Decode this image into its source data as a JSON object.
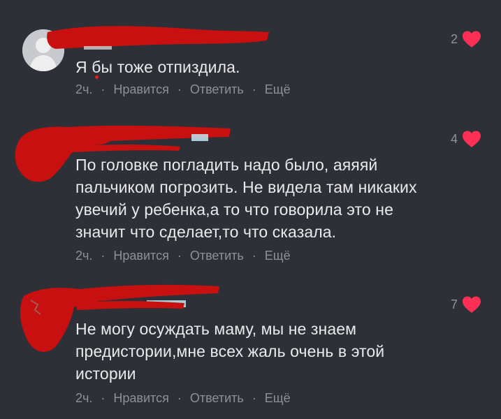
{
  "comments": [
    {
      "text": "Я бы тоже отпиздила.",
      "likes": "2",
      "time": "2ч.",
      "like_label": "Нравится",
      "reply_label": "Ответить",
      "more_label": "Ещё"
    },
    {
      "text": "По головке погладить надо было, аяяяй\nпальчиком погрозить. Не видела там никаких\nувечий у ребенка,а то что говорила это не\nзначит что сделает,то что сказала.",
      "likes": "4",
      "time": "2ч.",
      "like_label": "Нравится",
      "reply_label": "Ответить",
      "more_label": "Ещё"
    },
    {
      "text": "Не могу осуждать маму, мы не знаем\nпредистории,мне всех жаль очень в этой\nистории",
      "likes": "7",
      "time": "2ч.",
      "like_label": "Нравится",
      "reply_label": "Ответить",
      "more_label": "Ещё"
    }
  ],
  "separator": "·",
  "colors": {
    "background": "#2d3036",
    "heart": "#ff2e55",
    "redaction": "#c81010",
    "muted_text": "#8c9098"
  },
  "icons": {
    "like": "heart-icon",
    "avatar_placeholder": "person-silhouette-icon"
  }
}
